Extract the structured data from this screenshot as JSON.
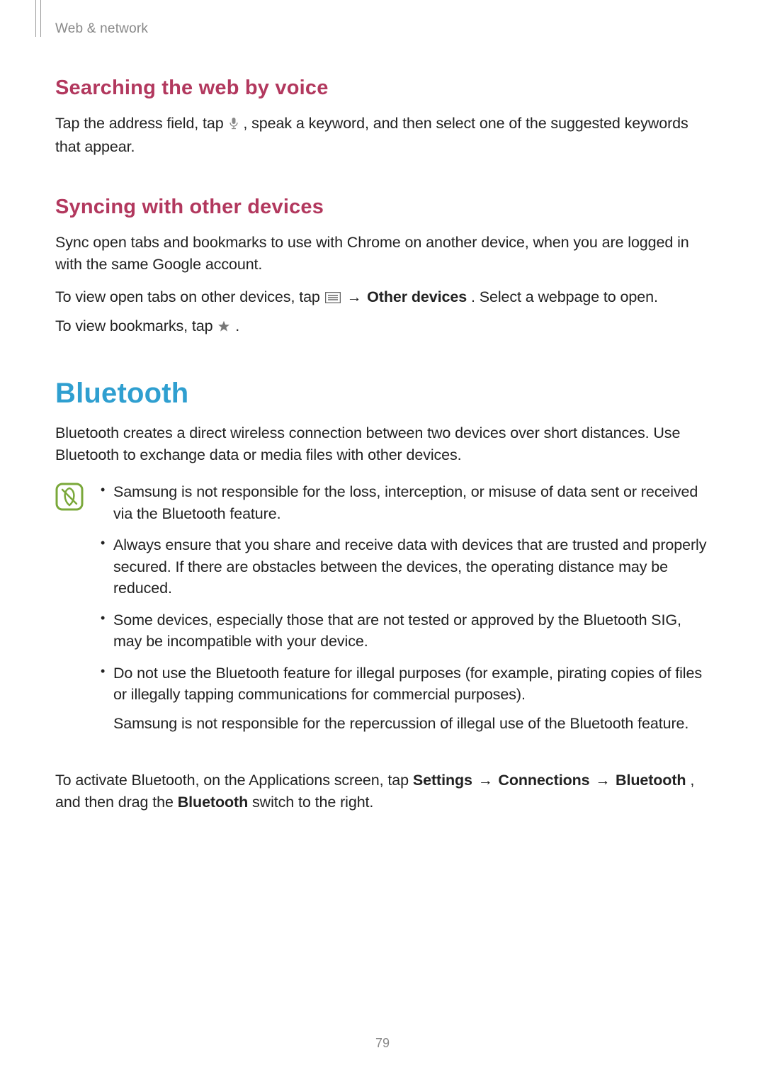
{
  "breadcrumb": "Web & network",
  "section1": {
    "heading": "Searching the web by voice",
    "para_a": "Tap the address field, tap ",
    "para_b": " , speak a keyword, and then select one of the suggested keywords that appear."
  },
  "section2": {
    "heading": "Syncing with other devices",
    "para1": "Sync open tabs and bookmarks to use with Chrome on another device, when you are logged in with the same Google account.",
    "para2_a": "To view open tabs on other devices, tap ",
    "arrow": " → ",
    "para2_bold": "Other devices",
    "para2_b": ". Select a webpage to open.",
    "para3_a": "To view bookmarks, tap ",
    "para3_b": " ."
  },
  "section3": {
    "heading": "Bluetooth",
    "para1": "Bluetooth creates a direct wireless connection between two devices over short distances. Use Bluetooth to exchange data or media files with other devices.",
    "notes": [
      "Samsung is not responsible for the loss, interception, or misuse of data sent or received via the Bluetooth feature.",
      "Always ensure that you share and receive data with devices that are trusted and properly secured. If there are obstacles between the devices, the operating distance may be reduced.",
      "Some devices, especially those that are not tested or approved by the Bluetooth SIG, may be incompatible with your device."
    ],
    "note4_a": "Do not use the Bluetooth feature for illegal purposes (for example, pirating copies of files or illegally tapping communications for commercial purposes).",
    "note4_b": "Samsung is not responsible for the repercussion of illegal use of the Bluetooth feature.",
    "para2_a": "To activate Bluetooth, on the Applications screen, tap ",
    "para2_b1": "Settings",
    "arrow1": " → ",
    "para2_b2": "Connections",
    "arrow2": " → ",
    "para2_b3": "Bluetooth",
    "para2_c": ", and then drag the ",
    "para2_b4": "Bluetooth",
    "para2_d": " switch to the right."
  },
  "page_number": "79"
}
